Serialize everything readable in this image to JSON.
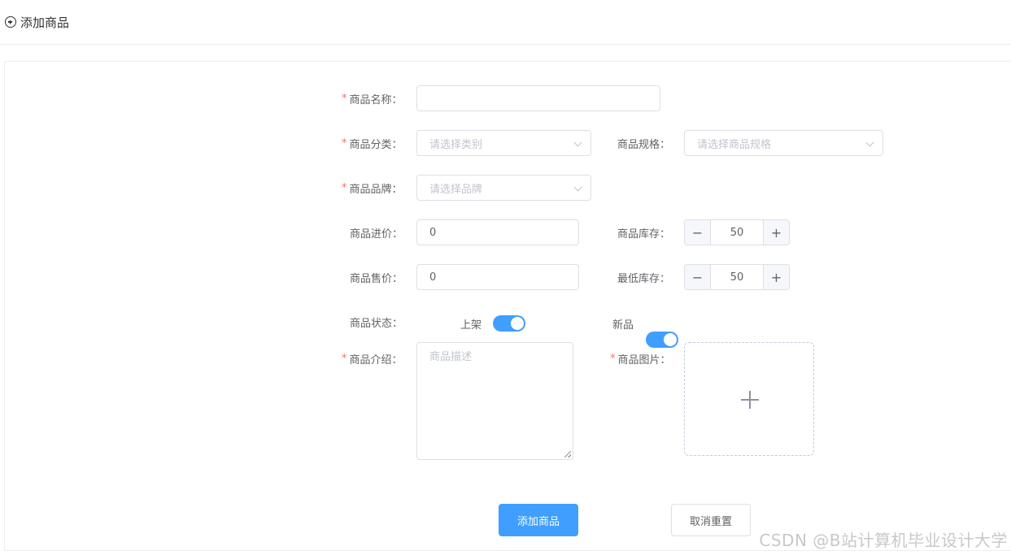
{
  "header": {
    "title": "添加商品",
    "icon": "plus-circle-icon"
  },
  "form": {
    "name": {
      "label": "商品名称：",
      "value": "",
      "required": true
    },
    "category": {
      "label": "商品分类：",
      "placeholder": "请选择类别",
      "required": true
    },
    "spec": {
      "label": "商品规格：",
      "placeholder": "请选择商品规格",
      "required": false
    },
    "brand": {
      "label": "商品品牌：",
      "placeholder": "请选择品牌",
      "required": true
    },
    "cost_price": {
      "label": "商品进价：",
      "value": "0"
    },
    "stock": {
      "label": "商品库存：",
      "value": "50",
      "dec": "−",
      "inc": "+"
    },
    "sale_price": {
      "label": "商品售价：",
      "value": "0"
    },
    "min_stock": {
      "label": "最低库存：",
      "value": "50",
      "dec": "−",
      "inc": "+"
    },
    "status": {
      "label": "商品状态：",
      "on_shelf_label": "上架",
      "on_shelf": true,
      "new_label": "新品",
      "is_new": true
    },
    "intro": {
      "label": "商品介绍：",
      "placeholder": "商品描述",
      "required": true
    },
    "image": {
      "label": "商品图片：",
      "required": true,
      "icon": "plus-icon"
    }
  },
  "actions": {
    "submit": "添加商品",
    "reset": "取消重置"
  },
  "watermark": "CSDN @B站计算机毕业设计大学",
  "colors": {
    "primary": "#409eff",
    "required": "#f56c6c",
    "border": "#dcdfe6",
    "placeholder": "#c0c4cc"
  }
}
